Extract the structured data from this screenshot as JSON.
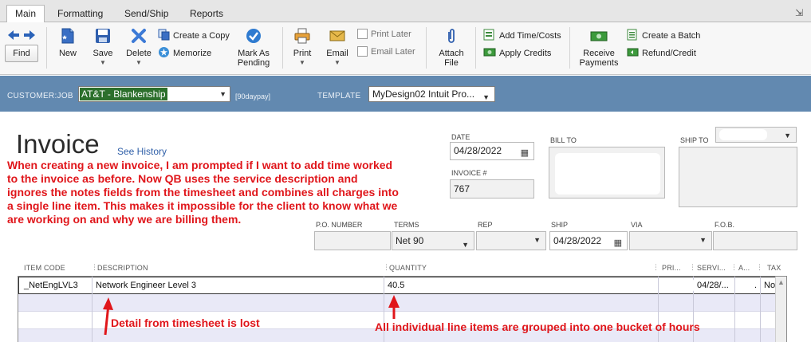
{
  "ribbon": {
    "tabs": [
      {
        "label": "Main",
        "active": true
      },
      {
        "label": "Formatting",
        "active": false
      },
      {
        "label": "Send/Ship",
        "active": false
      },
      {
        "label": "Reports",
        "active": false
      }
    ]
  },
  "toolbar": {
    "find": "Find",
    "new": "New",
    "save": "Save",
    "delete": "Delete",
    "create_copy": "Create a Copy",
    "memorize": "Memorize",
    "mark_as_pending_1": "Mark As",
    "mark_as_pending_2": "Pending",
    "print": "Print",
    "email": "Email",
    "print_later": "Print Later",
    "email_later": "Email Later",
    "attach_file_1": "Attach",
    "attach_file_2": "File",
    "add_time_costs": "Add Time/Costs",
    "apply_credits": "Apply Credits",
    "receive_payments_1": "Receive",
    "receive_payments_2": "Payments",
    "create_batch": "Create a Batch",
    "refund_credit": "Refund/Credit"
  },
  "customer_bar": {
    "customer_label": "CUSTOMER:JOB",
    "customer_value": "AT&T - Blankenship",
    "terms_tag": "[90daypay]",
    "template_label": "TEMPLATE",
    "template_value": "MyDesign02 Intuit Pro..."
  },
  "invoice": {
    "title": "Invoice",
    "see_history": "See History",
    "date_label": "DATE",
    "date_value": "04/28/2022",
    "invoice_no_label": "INVOICE #",
    "invoice_no_value": "767",
    "bill_to_label": "BILL TO",
    "ship_to_label": "SHIP TO",
    "po_label": "P.O. NUMBER",
    "terms_label": "TERMS",
    "terms_value": "Net 90",
    "rep_label": "REP",
    "ship_label": "SHIP",
    "ship_value": "04/28/2022",
    "via_label": "VIA",
    "fob_label": "F.O.B."
  },
  "annotations": {
    "main_note": [
      "When creating a new invoice, I am prompted if I want to add time worked",
      "to the invoice as before.  Now QB uses the service description and",
      "ignores the notes fields from the timesheet and combines all charges into",
      "a single line item. This makes it impossible for the client to know what we",
      "are working on and why we are billing them."
    ],
    "detail_lost": "Detail from timesheet is lost",
    "grouped": "All individual line items are grouped into one bucket of hours",
    "color": "#e0161b",
    "highlight_color": "#fbfb3c"
  },
  "table": {
    "headers": {
      "item_code": "ITEM CODE",
      "description": "DESCRIPTION",
      "quantity": "QUANTITY",
      "price": "PRI...",
      "service": "SERVI...",
      "amount": "A...",
      "tax": "TAX"
    },
    "rows": [
      {
        "item_code": "_NetEngLVL3",
        "description": "Network Engineer Level 3",
        "quantity": "40.5",
        "service_date": "04/28/...",
        "amount": ".",
        "tax": "Non"
      }
    ]
  },
  "colors": {
    "customer_bar": "#6289b0",
    "customer_selected": "#2c6f2c",
    "link": "#2f5fa8"
  }
}
